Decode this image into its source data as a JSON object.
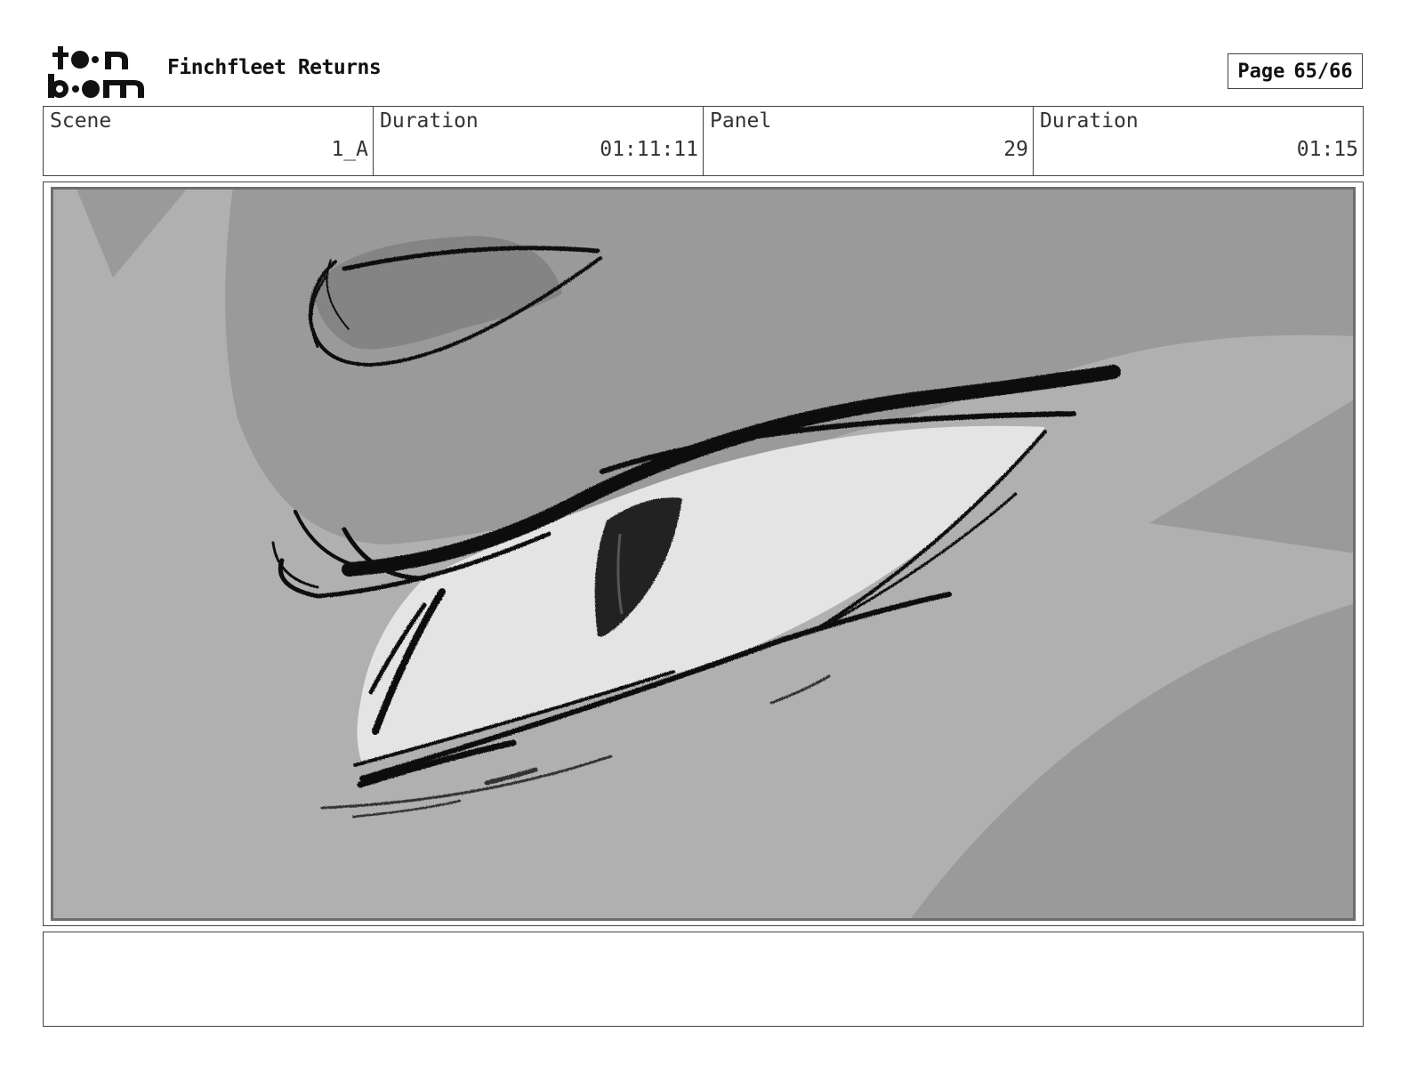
{
  "header": {
    "logo_name": "toon-boom-logo",
    "project_title": "Finchfleet Returns",
    "page_label": "Page",
    "page_number": "65/66"
  },
  "info": {
    "scene_label": "Scene",
    "scene_value": "1_A",
    "scene_duration_label": "Duration",
    "scene_duration_value": "01:11:11",
    "panel_label": "Panel",
    "panel_value": "29",
    "panel_duration_label": "Duration",
    "panel_duration_value": "01:15"
  },
  "panel_image": {
    "icon": "eye-sketch-drawing",
    "colors": {
      "skin_light": "#b0b0b0",
      "skin_dark": "#999999",
      "eye_white": "#e4e4e4",
      "ink": "#111111"
    }
  },
  "notes": {
    "text": ""
  }
}
